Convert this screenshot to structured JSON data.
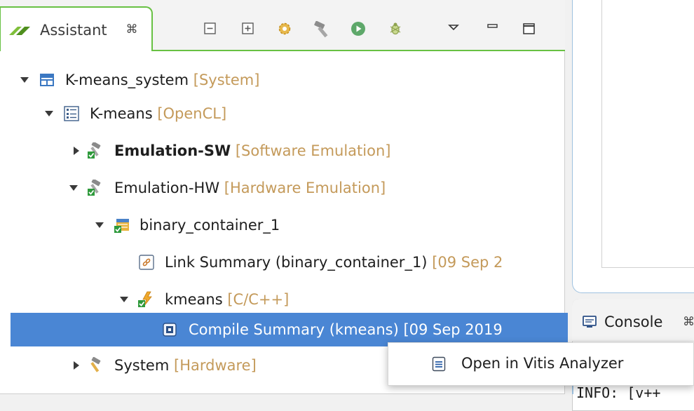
{
  "assistant": {
    "tab_label": "Assistant",
    "toolbar": [
      "collapse-all",
      "expand-all",
      "settings",
      "build",
      "run",
      "debug",
      "view-menu",
      "minimize",
      "maximize"
    ]
  },
  "tree": {
    "rows": [
      {
        "name": "K-means_system",
        "tag": "[System]",
        "icon": "system-icon",
        "expanded": true
      },
      {
        "name": "K-means",
        "tag": "[OpenCL]",
        "icon": "project-icon",
        "expanded": true
      },
      {
        "name": "Emulation-SW",
        "tag": "[Software Emulation]",
        "icon": "build-config-icon",
        "expanded": false,
        "bold": true
      },
      {
        "name": "Emulation-HW",
        "tag": "[Hardware Emulation]",
        "icon": "build-config-icon",
        "expanded": true
      },
      {
        "name": "binary_container_1",
        "tag": "",
        "icon": "binary-container-icon",
        "expanded": true
      },
      {
        "name": "Link Summary (binary_container_1)",
        "tag": "[09 Sep 2",
        "icon": "link-summary-icon"
      },
      {
        "name": "kmeans",
        "tag": "[C/C++]",
        "icon": "kernel-icon",
        "expanded": true
      },
      {
        "name": "Compile Summary (kmeans)",
        "tag": "[09 Sep 2019",
        "icon": "compile-summary-icon",
        "selected": true
      },
      {
        "name": "System",
        "tag": "[Hardware]",
        "icon": "hammer-icon",
        "expanded": false
      }
    ]
  },
  "console": {
    "label": "Console",
    "output": "INFO: [v++"
  },
  "context_menu": {
    "items": [
      {
        "label": "Open in Vitis Analyzer",
        "icon": "document-icon"
      }
    ]
  },
  "colors": {
    "accent_green": "#68c143",
    "selection": "#4a86d4",
    "tag_text": "#c49a5a"
  }
}
